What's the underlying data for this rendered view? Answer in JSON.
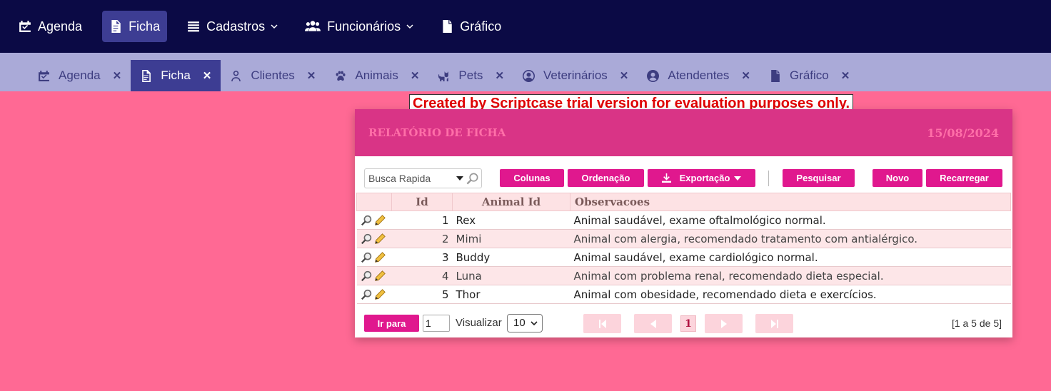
{
  "topnav": {
    "items": [
      {
        "label": "Agenda",
        "icon": "calendar-check-icon",
        "active": false
      },
      {
        "label": "Ficha",
        "icon": "file-text-icon",
        "active": true
      },
      {
        "label": "Cadastros",
        "icon": "list-icon",
        "active": false,
        "dropdown": true
      },
      {
        "label": "Funcionários",
        "icon": "users-icon",
        "active": false,
        "dropdown": true
      },
      {
        "label": "Gráfico",
        "icon": "file-icon",
        "active": false
      }
    ]
  },
  "tabs": [
    {
      "label": "Agenda",
      "icon": "calendar-check-icon"
    },
    {
      "label": "Ficha",
      "icon": "file-text-icon",
      "active": true
    },
    {
      "label": "Clientes",
      "icon": "user-icon"
    },
    {
      "label": "Animais",
      "icon": "paw-icon"
    },
    {
      "label": "Pets",
      "icon": "cat-icon"
    },
    {
      "label": "Veterinários",
      "icon": "user-circle-icon"
    },
    {
      "label": "Atendentes",
      "icon": "user-circle-solid-icon"
    },
    {
      "label": "Gráfico",
      "icon": "file-icon"
    }
  ],
  "tab_close": "✕",
  "trial_banner": "Created by Scriptcase trial version for evaluation purposes only.",
  "report": {
    "title": "RELATÓRIO DE FICHA",
    "date": "15/08/2024"
  },
  "toolbar": {
    "search_placeholder": "Busca Rapida",
    "colunas": "Colunas",
    "ordenacao": "Ordenação",
    "exportacao": "Exportação",
    "pesquisar": "Pesquisar",
    "novo": "Novo",
    "recarregar": "Recarregar"
  },
  "grid": {
    "headers": {
      "id": "Id",
      "animal": "Animal Id",
      "obs": "Observacoes"
    },
    "rows": [
      {
        "id": "1",
        "animal": "Rex",
        "obs": "Animal saudável, exame oftalmológico normal."
      },
      {
        "id": "2",
        "animal": "Mimi",
        "obs": "Animal com alergia, recomendado tratamento com antialérgico."
      },
      {
        "id": "3",
        "animal": "Buddy",
        "obs": "Animal saudável, exame cardiológico normal."
      },
      {
        "id": "4",
        "animal": "Luna",
        "obs": "Animal com problema renal, recomendado dieta especial."
      },
      {
        "id": "5",
        "animal": "Thor",
        "obs": "Animal com obesidade, recomendado dieta e exercícios."
      }
    ]
  },
  "footer": {
    "goto": "Ir para",
    "page_value": "1",
    "visualizar": "Visualizar",
    "page_size": "10",
    "current_page": "1",
    "summary": "[1 a 5 de 5]"
  },
  "colors": {
    "accent": "#e0188e",
    "nav": "#0b0a45",
    "tabbar": "#aaaad8",
    "background": "#ff6994"
  }
}
